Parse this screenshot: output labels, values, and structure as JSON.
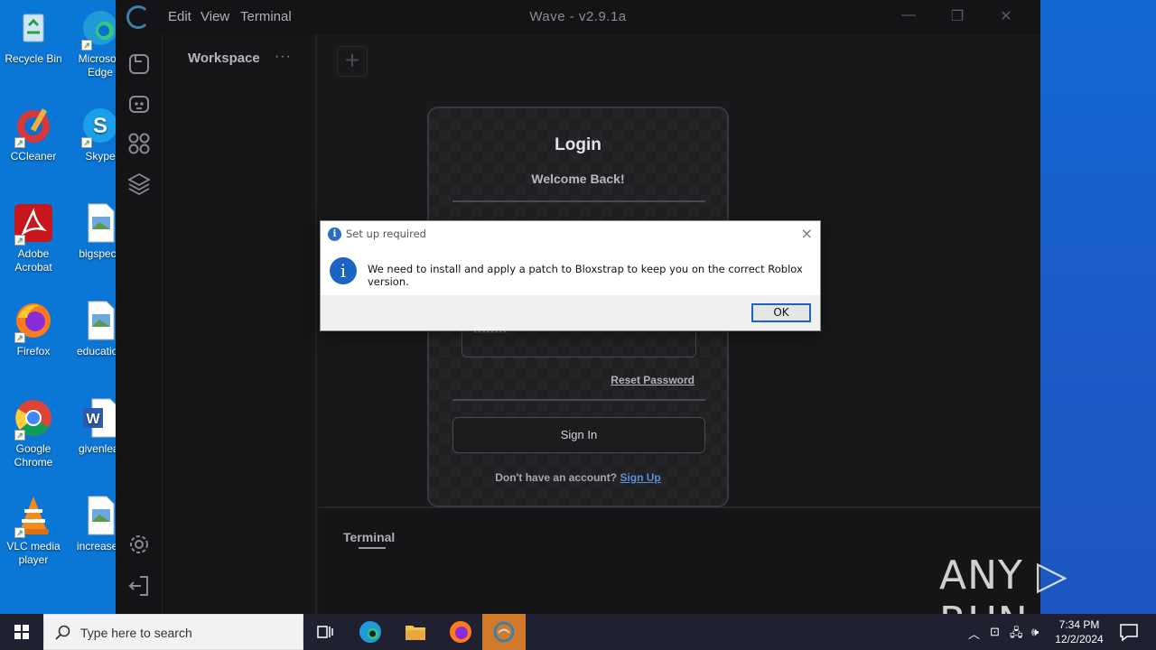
{
  "desktop": {
    "icons": [
      {
        "label": "Recycle Bin"
      },
      {
        "label": "Microsoft Edge"
      },
      {
        "label": "CCleaner"
      },
      {
        "label": "Skype"
      },
      {
        "label": "Adobe Acrobat"
      },
      {
        "label": "bigspecif"
      },
      {
        "label": "Firefox"
      },
      {
        "label": "education"
      },
      {
        "label": "Google Chrome"
      },
      {
        "label": "givenleat"
      },
      {
        "label": "VLC media player"
      },
      {
        "label": "increased"
      }
    ]
  },
  "app": {
    "title": "Wave - v2.9.1a",
    "menu": [
      "Edit",
      "View",
      "Terminal"
    ],
    "workspace_title": "Workspace",
    "workspace_menu": "···",
    "add_tab": "+",
    "terminal_tab": "Terminal",
    "sidebar_icons": [
      "file-icon",
      "robot-icon",
      "apps-grid-icon",
      "layers-icon",
      "settings-icon",
      "logout-icon"
    ],
    "accent": "#3c7fa8"
  },
  "login": {
    "title": "Login",
    "subtitle": "Welcome Back!",
    "password_value": "********",
    "reset_password": "Reset Password",
    "sign_in": "Sign In",
    "no_account": "Don't have an account?",
    "sign_up": "Sign Up"
  },
  "dialog": {
    "title": "Set up required",
    "message": "We need to install and apply a patch to Bloxstrap to keep you on the correct Roblox version.",
    "ok": "OK",
    "close": "×",
    "info_glyph": "i"
  },
  "watermark": "ANY ▷ RUN",
  "taskbar": {
    "search_placeholder": "Type here to search",
    "time": "7:34 PM",
    "date": "12/2/2024",
    "active_color": "#d07a2a"
  }
}
